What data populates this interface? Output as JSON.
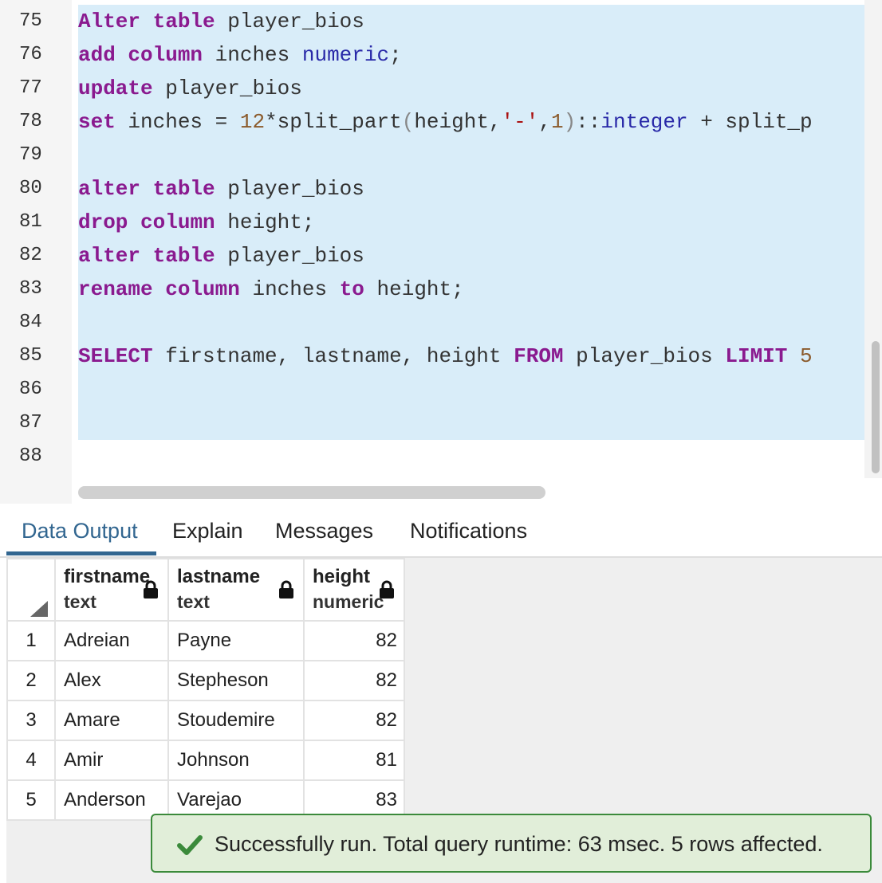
{
  "editor": {
    "lines": [
      {
        "num": "75",
        "segs": [
          {
            "t": "Alter",
            "c": "kw"
          },
          {
            "t": " "
          },
          {
            "t": "table",
            "c": "kw"
          },
          {
            "t": " player_bios"
          }
        ]
      },
      {
        "num": "76",
        "segs": [
          {
            "t": "add",
            "c": "kw"
          },
          {
            "t": " "
          },
          {
            "t": "column",
            "c": "kw"
          },
          {
            "t": " inches "
          },
          {
            "t": "numeric",
            "c": "ty"
          },
          {
            "t": ";"
          }
        ]
      },
      {
        "num": "77",
        "segs": [
          {
            "t": "update",
            "c": "kw"
          },
          {
            "t": " player_bios"
          }
        ]
      },
      {
        "num": "78",
        "segs": [
          {
            "t": "set",
            "c": "kw"
          },
          {
            "t": " inches = "
          },
          {
            "t": "12",
            "c": "num"
          },
          {
            "t": "*split_part"
          },
          {
            "t": "(",
            "c": "pn"
          },
          {
            "t": "height,"
          },
          {
            "t": "'-'",
            "c": "str"
          },
          {
            "t": ","
          },
          {
            "t": "1",
            "c": "num"
          },
          {
            "t": ")",
            "c": "pn"
          },
          {
            "t": "::"
          },
          {
            "t": "integer",
            "c": "ty"
          },
          {
            "t": " + split_p"
          }
        ]
      },
      {
        "num": "79",
        "segs": []
      },
      {
        "num": "80",
        "segs": [
          {
            "t": "alter",
            "c": "kw"
          },
          {
            "t": " "
          },
          {
            "t": "table",
            "c": "kw"
          },
          {
            "t": " player_bios"
          }
        ]
      },
      {
        "num": "81",
        "segs": [
          {
            "t": "drop",
            "c": "kw"
          },
          {
            "t": " "
          },
          {
            "t": "column",
            "c": "kw"
          },
          {
            "t": " height;"
          }
        ]
      },
      {
        "num": "82",
        "segs": [
          {
            "t": "alter",
            "c": "kw"
          },
          {
            "t": " "
          },
          {
            "t": "table",
            "c": "kw"
          },
          {
            "t": " player_bios"
          }
        ]
      },
      {
        "num": "83",
        "segs": [
          {
            "t": "rename",
            "c": "kw"
          },
          {
            "t": " "
          },
          {
            "t": "column",
            "c": "kw"
          },
          {
            "t": " inches "
          },
          {
            "t": "to",
            "c": "kw"
          },
          {
            "t": " height;"
          }
        ]
      },
      {
        "num": "84",
        "segs": []
      },
      {
        "num": "85",
        "segs": [
          {
            "t": "SELECT",
            "c": "kw"
          },
          {
            "t": " firstname, lastname, height "
          },
          {
            "t": "FROM",
            "c": "kw"
          },
          {
            "t": " player_bios "
          },
          {
            "t": "LIMIT",
            "c": "kw"
          },
          {
            "t": " "
          },
          {
            "t": "5",
            "c": "num"
          }
        ]
      },
      {
        "num": "86",
        "segs": []
      },
      {
        "num": "87",
        "segs": []
      },
      {
        "num": "88",
        "segs": []
      }
    ]
  },
  "tabs": [
    {
      "label": "Data Output",
      "active": true
    },
    {
      "label": "Explain",
      "active": false
    },
    {
      "label": "Messages",
      "active": false
    },
    {
      "label": "Notifications",
      "active": false
    }
  ],
  "grid": {
    "columns": [
      {
        "name": "firstname",
        "type": "text"
      },
      {
        "name": "lastname",
        "type": "text"
      },
      {
        "name": "height",
        "type": "numeric"
      }
    ],
    "rows": [
      {
        "n": "1",
        "firstname": "Adreian",
        "lastname": "Payne",
        "height": "82"
      },
      {
        "n": "2",
        "firstname": "Alex",
        "lastname": "Stepheson",
        "height": "82"
      },
      {
        "n": "3",
        "firstname": "Amare",
        "lastname": "Stoudemire",
        "height": "82"
      },
      {
        "n": "4",
        "firstname": "Amir",
        "lastname": "Johnson",
        "height": "81"
      },
      {
        "n": "5",
        "firstname": "Anderson",
        "lastname": "Varejao",
        "height": "83"
      }
    ]
  },
  "toast": {
    "message": "Successfully run. Total query runtime: 63 msec. 5 rows affected.",
    "icon": "check-icon",
    "color": "#3b8a3b"
  }
}
